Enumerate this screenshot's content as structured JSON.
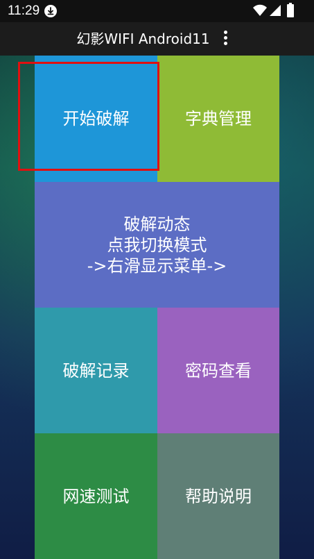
{
  "status_bar": {
    "time": "11:29",
    "icons": [
      "download-icon",
      "wifi-icon",
      "signal-icon",
      "battery-icon"
    ]
  },
  "title_bar": {
    "title": "幻影WIFI Android11",
    "menu_icon": "more-vert-icon"
  },
  "tiles": {
    "start": {
      "label": "开始破解",
      "color": "#1e96d8"
    },
    "dict": {
      "label": "字典管理",
      "color": "#8fbb36"
    },
    "dynamic": {
      "lines": [
        "破解动态",
        "点我切换模式",
        "->右滑显示菜单->"
      ],
      "color": "#5c6dc4"
    },
    "record": {
      "label": "破解记录",
      "color": "#2f9aab"
    },
    "password": {
      "label": "密码查看",
      "color": "#9a62bf"
    },
    "speed": {
      "label": "网速测试",
      "color": "#2d8c45"
    },
    "help": {
      "label": "帮助说明",
      "color": "#5f7f76"
    }
  },
  "highlight": {
    "target": "start",
    "color": "#e01010"
  }
}
